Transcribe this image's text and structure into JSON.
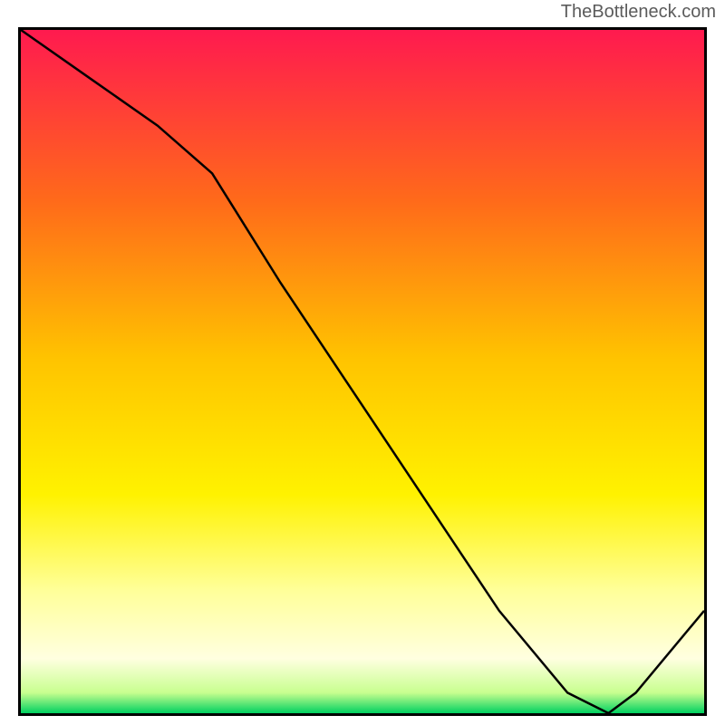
{
  "attribution": "TheBottleneck.com",
  "annotation_label": "",
  "chart_data": {
    "type": "line",
    "title": "",
    "xlabel": "",
    "ylabel": "",
    "xlim": [
      0,
      100
    ],
    "ylim": [
      0,
      100
    ],
    "grid": false,
    "series": [
      {
        "name": "curve",
        "x": [
          0,
          10,
          20,
          28,
          38,
          50,
          60,
          70,
          80,
          86,
          90,
          100
        ],
        "values": [
          100,
          93,
          86,
          79,
          63,
          45,
          30,
          15,
          3,
          0,
          3,
          15
        ]
      }
    ],
    "gradient_stops": [
      {
        "offset": 0,
        "color": "#ff1a4f"
      },
      {
        "offset": 25,
        "color": "#ff6a1a"
      },
      {
        "offset": 48,
        "color": "#ffc300"
      },
      {
        "offset": 68,
        "color": "#fff200"
      },
      {
        "offset": 82,
        "color": "#ffff99"
      },
      {
        "offset": 92,
        "color": "#ffffe0"
      },
      {
        "offset": 97,
        "color": "#c8ff8f"
      },
      {
        "offset": 100,
        "color": "#00d060"
      }
    ]
  }
}
